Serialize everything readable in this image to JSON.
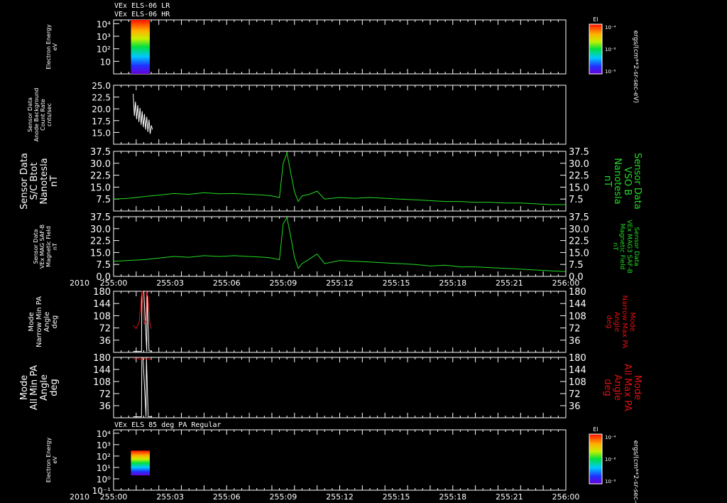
{
  "header": {
    "line1": "VEx ELS-06 LR",
    "line2": "VEx ELS-06 HR"
  },
  "x_axis": {
    "year": "2010",
    "ticks": [
      "255:00",
      "255:03",
      "255:06",
      "255:09",
      "255:12",
      "255:15",
      "255:18",
      "255:21",
      "256:00"
    ],
    "range_minutes": [
      0,
      60
    ]
  },
  "colors": {
    "white": "#ffffff",
    "green": "#22dd22",
    "red": "#dd1111",
    "background": "#000000"
  },
  "chart_data": [
    {
      "type": "heatmap",
      "name": "spectrogram_lr_hr",
      "left_label": [
        "Electron Energy",
        "eV"
      ],
      "y_scale": "log",
      "ylim": [
        1,
        20000
      ],
      "yticks": [
        {
          "v": 10,
          "t": "10"
        },
        {
          "v": 100,
          "t": "10²"
        },
        {
          "v": 1000,
          "t": "10³"
        },
        {
          "v": 10000,
          "t": "10⁴"
        }
      ],
      "x_extent_minutes": [
        2.3,
        4.8
      ],
      "y_extent_ev": [
        1,
        20000
      ],
      "colorbar": {
        "title": "El",
        "ticks": [
          "10⁻⁴",
          "10⁻⁸",
          "10⁻⁸"
        ],
        "unit": "ergs/(cm**2-sr-sec-eV)"
      }
    },
    {
      "type": "line",
      "name": "anode_background",
      "left_label": [
        "Sensor Data",
        "Anode Background",
        "Count Rate",
        "cnts/sec"
      ],
      "ylim": [
        12.5,
        25.0
      ],
      "yticks": [
        "15.0",
        "17.5",
        "20.0",
        "22.5",
        "25.0"
      ],
      "series": [
        {
          "color": "white",
          "x": [
            2.6,
            2.75,
            2.9,
            3.05,
            3.2,
            3.35,
            3.5,
            3.65,
            3.8,
            3.95,
            4.1,
            4.25,
            4.4,
            4.55,
            4.7,
            4.85,
            5.0,
            5.15
          ],
          "values": [
            23.2,
            18.5,
            21.5,
            17.8,
            20.8,
            17.2,
            20.2,
            16.6,
            19.5,
            16.1,
            18.9,
            15.6,
            18.3,
            15.1,
            17.7,
            14.7,
            16.5,
            15.6
          ]
        }
      ]
    },
    {
      "type": "line",
      "name": "sc_btot",
      "left_label": [
        "Sensor Data",
        "S/C Btot",
        "Nanotesla",
        "nT"
      ],
      "right_label": [
        "Sensor Data",
        "VSO B",
        "Nanotesla",
        "nT"
      ],
      "ylim": [
        0,
        37.5
      ],
      "yticks": [
        "7.5",
        "15.0",
        "22.5",
        "30.0",
        "37.5"
      ],
      "series": [
        {
          "color": "green",
          "x": [
            0,
            2,
            4,
            6,
            8,
            10,
            12,
            14,
            16,
            18,
            20,
            21,
            22,
            22.5,
            23,
            23.5,
            24,
            24.5,
            25,
            26,
            27,
            28,
            30,
            32,
            34,
            36,
            38,
            40,
            42,
            44,
            46,
            48,
            50,
            52,
            54,
            56,
            58,
            60
          ],
          "values": [
            7.5,
            8.0,
            9.0,
            10.0,
            11.0,
            10.5,
            11.5,
            10.8,
            11.0,
            10.5,
            10.0,
            9.5,
            8.5,
            30.0,
            36.5,
            24.0,
            12.0,
            6.0,
            9.5,
            10.5,
            12.5,
            7.5,
            8.5,
            8.0,
            8.5,
            8.0,
            7.5,
            7.0,
            6.5,
            6.0,
            6.0,
            5.5,
            5.5,
            5.0,
            5.0,
            4.5,
            4.0,
            4.0
          ]
        }
      ]
    },
    {
      "type": "line",
      "name": "mag3_safb",
      "left_label": [
        "Sensor Data",
        "VEx MAG SAF-B",
        "Magnetic Field",
        "nT"
      ],
      "right_label": [
        "Sensor Data",
        "VEx MAG3 SAF-B",
        "Magnetic Field",
        "nT"
      ],
      "ylim": [
        0,
        37.5
      ],
      "yticks": [
        "0.0",
        "7.5",
        "15.0",
        "22.5",
        "30.0",
        "37.5"
      ],
      "series": [
        {
          "color": "green",
          "x": [
            0,
            2,
            4,
            6,
            8,
            10,
            12,
            14,
            16,
            18,
            20,
            21,
            22,
            22.5,
            23,
            23.5,
            24,
            24.5,
            25,
            26,
            27,
            28,
            30,
            32,
            34,
            36,
            38,
            40,
            42,
            44,
            46,
            48,
            50,
            52,
            54,
            56,
            58,
            60
          ],
          "values": [
            9.5,
            10.0,
            10.5,
            11.5,
            12.5,
            12.0,
            13.0,
            12.5,
            13.0,
            12.5,
            12.0,
            11.5,
            10.5,
            33.0,
            37.0,
            25.0,
            12.0,
            5.0,
            8.0,
            11.0,
            14.0,
            8.0,
            10.0,
            9.5,
            9.0,
            8.5,
            8.0,
            7.5,
            6.5,
            7.0,
            6.0,
            6.0,
            5.5,
            5.0,
            4.5,
            4.0,
            3.5,
            3.0
          ]
        }
      ]
    },
    {
      "type": "line",
      "name": "narrow_pa",
      "left_label": [
        "Mode",
        "Narrow Min PA",
        "Angle",
        "deg"
      ],
      "right_label": [
        "Mode",
        "Narrow Max PA",
        "Angle",
        "deg"
      ],
      "ylim": [
        0,
        180
      ],
      "yticks": [
        "36",
        "72",
        "108",
        "144",
        "180"
      ],
      "series": [
        {
          "color": "white",
          "x": [
            2.6,
            3.2,
            3.7,
            3.75,
            4.0,
            4.4,
            4.45,
            4.7,
            5.1
          ],
          "values": [
            3,
            3,
            3,
            180,
            180,
            3,
            180,
            5,
            3
          ]
        },
        {
          "color": "red",
          "x": [
            2.6,
            3.0,
            3.4,
            3.75,
            3.8,
            4.05,
            4.3,
            4.35,
            4.6,
            4.8,
            5.0
          ],
          "values": [
            80,
            70,
            90,
            180,
            180,
            85,
            95,
            180,
            160,
            90,
            70
          ]
        }
      ]
    },
    {
      "type": "line",
      "name": "all_pa",
      "left_label": [
        "Mode",
        "All Min PA",
        "Angle",
        "deg"
      ],
      "right_label": [
        "Mode",
        "All Max PA",
        "Angle",
        "deg"
      ],
      "ylim": [
        0,
        180
      ],
      "yticks": [
        "36",
        "72",
        "108",
        "144",
        "180"
      ],
      "series": [
        {
          "color": "white",
          "x": [
            2.6,
            3.2,
            3.7,
            3.75,
            3.9,
            4.3,
            4.35,
            4.6,
            5.1
          ],
          "values": [
            3,
            3,
            3,
            180,
            180,
            3,
            180,
            3,
            3
          ]
        },
        {
          "color": "red",
          "x": [
            2.6,
            3.2,
            3.7,
            3.9,
            4.3,
            4.6,
            5.1
          ],
          "values": [
            175,
            177,
            172,
            178,
            175,
            176,
            172
          ]
        }
      ]
    },
    {
      "type": "heatmap",
      "name": "spectrogram_85deg",
      "title": "VEx ELS 85 deg PA Regular",
      "left_label": [
        "Electron Energy",
        "eV"
      ],
      "y_scale": "log",
      "ylim": [
        0.1,
        20000
      ],
      "yticks": [
        {
          "v": 0.1,
          "t": "10⁻¹"
        },
        {
          "v": 1,
          "t": "10⁰"
        },
        {
          "v": 10,
          "t": "10¹"
        },
        {
          "v": 100,
          "t": "10²"
        },
        {
          "v": 1000,
          "t": "10³"
        },
        {
          "v": 10000,
          "t": "10⁴"
        }
      ],
      "x_extent_minutes": [
        2.3,
        4.8
      ],
      "y_extent_ev": [
        2,
        300
      ],
      "colorbar": {
        "title": "El",
        "ticks": [
          "10⁻⁴",
          "10⁻⁸",
          "10⁻⁸"
        ],
        "unit": "ergs/(cm**2-sr-sec-eV)"
      }
    }
  ]
}
